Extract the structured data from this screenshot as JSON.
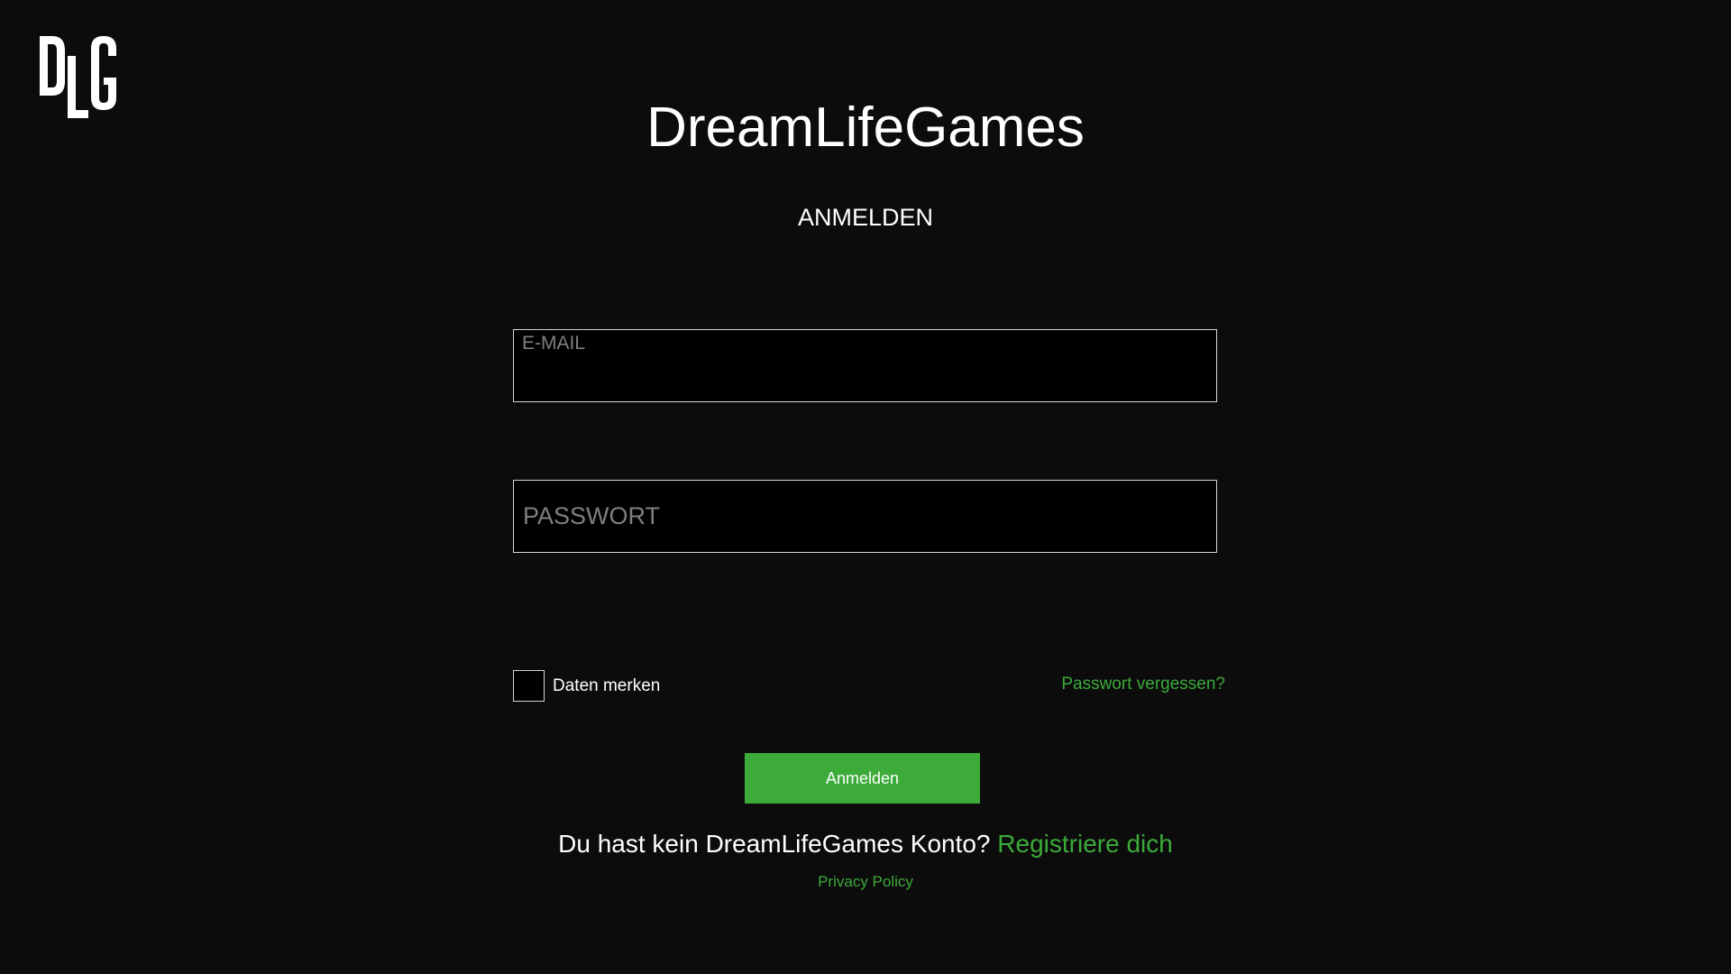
{
  "logo": {
    "text": "DLG",
    "icon": "dlg-logo"
  },
  "header": {
    "title": "DreamLifeGames",
    "subtitle": "ANMELDEN"
  },
  "form": {
    "email": {
      "placeholder": "E-MAIL",
      "value": ""
    },
    "password": {
      "placeholder": "PASSWORT",
      "value": ""
    },
    "remember": {
      "label": "Daten merken",
      "checked": false
    },
    "forgot_label": "Passwort vergessen?",
    "submit_label": "Anmelden"
  },
  "footer": {
    "register_prompt": "Du hast kein DreamLifeGames Konto?",
    "register_link": "Registriere dich",
    "privacy_label": "Privacy Policy"
  },
  "colors": {
    "background": "#0c0c0c",
    "accent": "#3cab3a",
    "field_background": "#000000",
    "field_border": "#d6d6d6",
    "placeholder": "#7f7f7f"
  }
}
